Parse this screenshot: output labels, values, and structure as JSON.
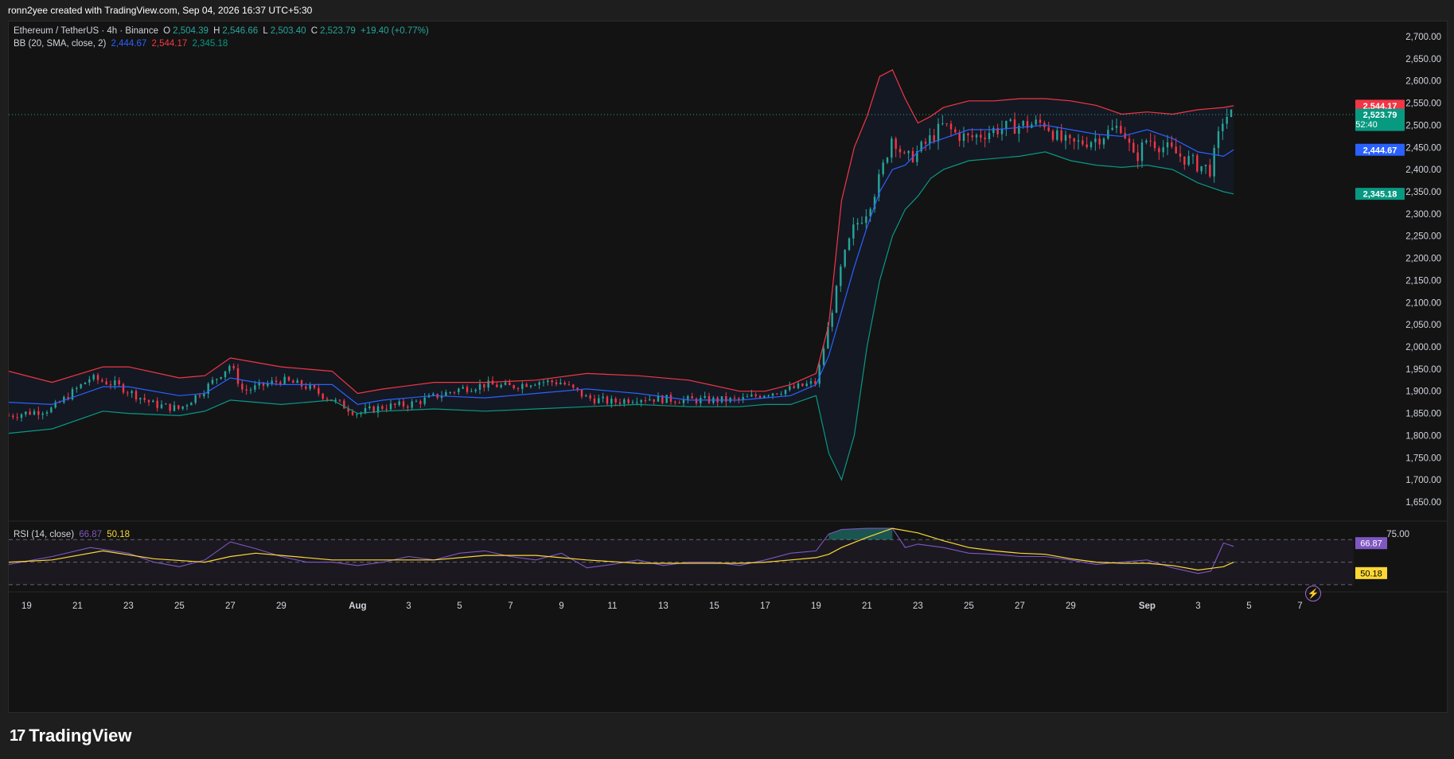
{
  "caption": "ronn2yee created with TradingView.com, Sep 04, 2026 16:37 UTC+5:30",
  "brand": "TradingView",
  "legend": {
    "symbol": "Ethereum / TetherUS · 4h · Binance",
    "o_label": "O",
    "o_value": "2,504.39",
    "h_label": "H",
    "h_value": "2,546.66",
    "l_label": "L",
    "l_value": "2,503.40",
    "c_label": "C",
    "c_value": "2,523.79",
    "change": "+19.40 (+0.77%)",
    "bb_label": "BB (20, SMA, close, 2)",
    "bb_basis": "2,444.67",
    "bb_upper": "2,544.17",
    "bb_lower": "2,345.18",
    "rsi_label": "RSI (14, close)",
    "rsi_value": "66.87",
    "rsi_ma": "50.18"
  },
  "colors": {
    "up": "#26a69a",
    "down": "#f23645",
    "bb_upper": "#f23645",
    "bb_basis": "#2962ff",
    "bb_lower": "#089981",
    "rsi": "#7e57c2",
    "rsi_ma": "#fdd835"
  },
  "chart_data": [
    {
      "type": "candlestick",
      "title": "Ethereum / TetherUS · 4h · Binance",
      "y_axis_ticks": [
        "2,700.00",
        "2,650.00",
        "2,600.00",
        "2,550.00",
        "2,500.00",
        "2,450.00",
        "2,400.00",
        "2,350.00",
        "2,300.00",
        "2,250.00",
        "2,200.00",
        "2,150.00",
        "2,100.00",
        "2,050.00",
        "2,000.00",
        "1,950.00",
        "1,900.00",
        "1,850.00",
        "1,800.00",
        "1,750.00",
        "1,700.00",
        "1,650.00"
      ],
      "y_tick_values": [
        2700,
        2650,
        2600,
        2550,
        2500,
        2450,
        2400,
        2350,
        2300,
        2250,
        2200,
        2150,
        2100,
        2050,
        2000,
        1950,
        1900,
        1850,
        1800,
        1750,
        1700,
        1650
      ],
      "ylim": [
        1630,
        2725
      ],
      "x_axis_ticks": [
        "19",
        "21",
        "23",
        "25",
        "27",
        "29",
        "Aug",
        "3",
        "5",
        "7",
        "9",
        "11",
        "13",
        "15",
        "17",
        "19",
        "21",
        "23",
        "25",
        "27",
        "29",
        "Sep",
        "3",
        "5",
        "7"
      ],
      "x_tick_days": [
        -12,
        -10,
        -8,
        -6,
        -4,
        -2,
        1,
        3,
        5,
        7,
        9,
        11,
        13,
        15,
        17,
        19,
        21,
        23,
        25,
        27,
        29,
        32,
        34,
        36,
        38
      ],
      "x_range_days": [
        -12.7,
        39.8
      ],
      "last_day": 35.4,
      "price_path_days": [
        -12.7,
        -11,
        -9.5,
        -8.5,
        -7,
        -6,
        -5,
        -4,
        -3.5,
        -2,
        -1,
        0,
        1,
        2,
        3,
        5,
        6,
        7,
        8,
        9,
        10,
        11,
        12,
        14,
        16,
        17,
        18,
        19,
        19.5,
        20,
        20.5,
        21,
        21.5,
        22,
        22.5,
        23,
        24,
        24.5,
        25,
        26,
        27,
        28,
        28.5,
        29,
        30,
        31,
        31.5,
        32,
        33,
        34,
        34.5,
        35,
        35.4
      ],
      "price_path_close": [
        1845,
        1860,
        1930,
        1915,
        1870,
        1860,
        1905,
        1960,
        1900,
        1925,
        1910,
        1880,
        1850,
        1865,
        1870,
        1905,
        1915,
        1910,
        1922,
        1920,
        1885,
        1875,
        1885,
        1880,
        1880,
        1895,
        1905,
        1920,
        2050,
        2180,
        2270,
        2310,
        2380,
        2480,
        2420,
        2440,
        2500,
        2480,
        2470,
        2490,
        2500,
        2505,
        2470,
        2455,
        2470,
        2500,
        2420,
        2470,
        2440,
        2410,
        2400,
        2520,
        2524
      ],
      "bollinger_days": [
        -12.7,
        -11,
        -9,
        -8,
        -6,
        -5,
        -4,
        -3,
        -2,
        0,
        1,
        2,
        4,
        6,
        8,
        10,
        12,
        14,
        16,
        17,
        18,
        19,
        19.5,
        20,
        20.5,
        21,
        21.5,
        22,
        22.5,
        23,
        23.5,
        24,
        25,
        26,
        27,
        28,
        29,
        30,
        31,
        32,
        33,
        34,
        35,
        35.4
      ],
      "bollinger_upper": [
        1945,
        1920,
        1955,
        1955,
        1930,
        1935,
        1975,
        1965,
        1955,
        1945,
        1895,
        1905,
        1920,
        1920,
        1925,
        1940,
        1935,
        1925,
        1900,
        1900,
        1915,
        1940,
        2050,
        2330,
        2450,
        2520,
        2610,
        2625,
        2560,
        2505,
        2520,
        2540,
        2555,
        2555,
        2560,
        2560,
        2555,
        2545,
        2525,
        2530,
        2525,
        2535,
        2540,
        2544
      ],
      "bollinger_basis": [
        1875,
        1870,
        1910,
        1910,
        1890,
        1895,
        1930,
        1920,
        1915,
        1915,
        1870,
        1880,
        1890,
        1885,
        1895,
        1905,
        1895,
        1880,
        1880,
        1885,
        1890,
        1915,
        1980,
        2080,
        2180,
        2270,
        2350,
        2400,
        2410,
        2440,
        2460,
        2470,
        2490,
        2490,
        2495,
        2500,
        2490,
        2480,
        2475,
        2490,
        2470,
        2440,
        2430,
        2445
      ],
      "bollinger_lower": [
        1805,
        1815,
        1855,
        1850,
        1845,
        1855,
        1880,
        1875,
        1870,
        1880,
        1850,
        1855,
        1860,
        1855,
        1860,
        1865,
        1870,
        1865,
        1865,
        1870,
        1870,
        1890,
        1760,
        1700,
        1800,
        2000,
        2150,
        2250,
        2310,
        2340,
        2380,
        2400,
        2420,
        2425,
        2430,
        2440,
        2420,
        2410,
        2405,
        2410,
        2400,
        2370,
        2350,
        2345
      ],
      "last_price_label": "2,523.79",
      "countdown_label": "52:40",
      "upper_label": "2,544.17",
      "basis_label": "2,444.67",
      "lower_label": "2,345.18"
    },
    {
      "type": "line",
      "title": "RSI (14, close)",
      "levels": [
        70,
        50,
        30
      ],
      "level_labels": [
        "75.00"
      ],
      "ylim": [
        25,
        85
      ],
      "rsi_days": [
        -12.7,
        -11,
        -9.5,
        -8,
        -7,
        -6,
        -5,
        -4,
        -3,
        -2,
        -1,
        0,
        1,
        2,
        3,
        4,
        5,
        6,
        7,
        8,
        9,
        10,
        11,
        12,
        13,
        14,
        15,
        16,
        17,
        18,
        19,
        19.5,
        20,
        21,
        22,
        22.5,
        23,
        24,
        25,
        26,
        27,
        28,
        29,
        30,
        31,
        32,
        33,
        34,
        34.5,
        35,
        35.4
      ],
      "rsi_values": [
        48,
        55,
        63,
        58,
        50,
        46,
        52,
        68,
        62,
        55,
        50,
        50,
        47,
        50,
        55,
        52,
        58,
        60,
        55,
        52,
        58,
        45,
        48,
        52,
        47,
        50,
        50,
        47,
        52,
        58,
        60,
        75,
        79,
        80,
        80,
        63,
        66,
        63,
        58,
        57,
        55,
        55,
        52,
        48,
        50,
        52,
        45,
        40,
        42,
        67,
        64,
        67
      ],
      "rsi_ma_days": [
        -12.7,
        -11,
        -9,
        -7,
        -5,
        -4,
        -3,
        -2,
        0,
        2,
        4,
        6,
        8,
        10,
        12,
        14,
        16,
        17,
        18,
        19,
        19.5,
        20,
        21,
        22,
        23,
        24,
        25,
        26,
        27,
        28,
        29,
        30,
        31,
        32,
        33,
        34,
        35,
        35.4
      ],
      "rsi_ma_values": [
        50,
        52,
        60,
        53,
        50,
        55,
        58,
        56,
        52,
        52,
        52,
        56,
        56,
        52,
        49,
        49,
        49,
        50,
        52,
        54,
        57,
        63,
        72,
        80,
        76,
        69,
        63,
        60,
        58,
        57,
        53,
        50,
        49,
        49,
        47,
        43,
        46,
        50
      ],
      "rsi_value_label": "66.87",
      "rsi_ma_label": "50.18"
    }
  ]
}
